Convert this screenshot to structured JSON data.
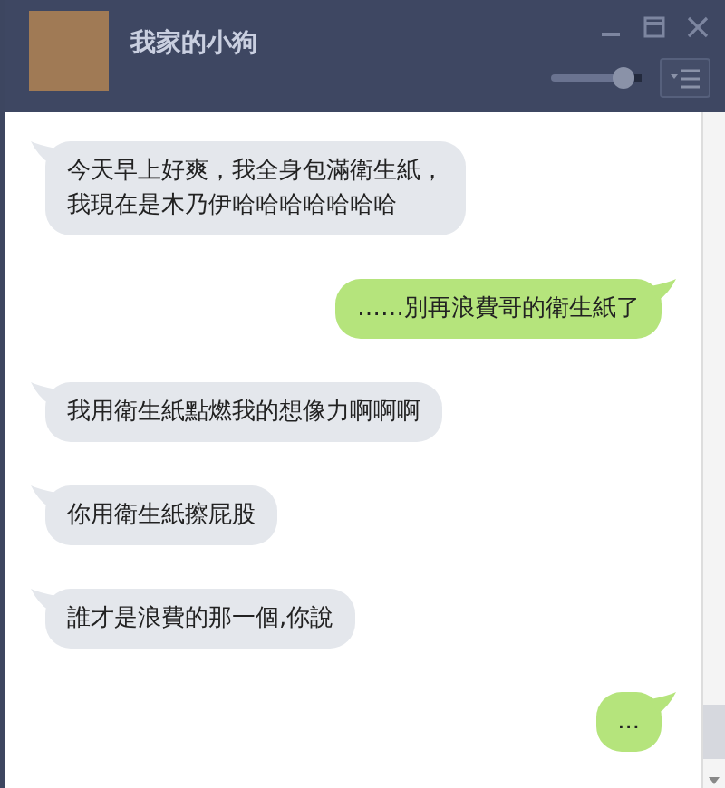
{
  "window": {
    "title": "我家的小狗"
  },
  "volume": {
    "level": 0.92
  },
  "messages": [
    {
      "kind": "incoming",
      "text": "今天早上好爽，我全身包滿衛生紙，",
      "text_2": "我現在是木乃伊哈哈哈哈哈哈哈"
    },
    {
      "kind": "outgoing",
      "text": "……別再浪費哥的衛生紙了"
    },
    {
      "kind": "incoming",
      "text": "我用衛生紙點燃我的想像力啊啊啊"
    },
    {
      "kind": "incoming",
      "text": "你用衛生紙擦屁股"
    },
    {
      "kind": "incoming",
      "text": "誰才是浪費的那一個,你說"
    },
    {
      "kind": "outgoing",
      "text": "..."
    }
  ]
}
